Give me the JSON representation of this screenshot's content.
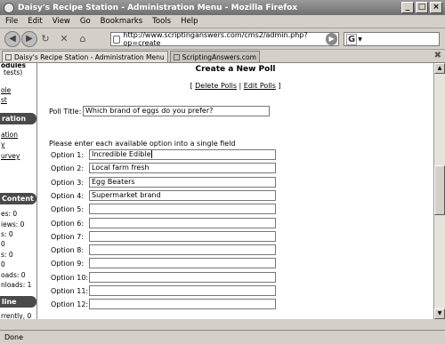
{
  "window": {
    "title": "Daisy's Recipe Station - Administration Menu - Mozilla Firefox"
  },
  "menu": [
    "File",
    "Edit",
    "View",
    "Go",
    "Bookmarks",
    "Tools",
    "Help"
  ],
  "address": {
    "url": "http://www.scriptinganswers.com/cms2/admin.php?op=create"
  },
  "search": {
    "engine": "G"
  },
  "tabs": [
    {
      "label": "Daisy's Recipe Station - Administration Menu"
    },
    {
      "label": "ScriptingAnswers.com"
    }
  ],
  "sidebar": {
    "lines_top": [
      "odules",
      "tests)"
    ],
    "links_top": [
      "ole",
      "st"
    ],
    "header1": "ration",
    "links1": [
      "ation",
      "y",
      "urvey"
    ],
    "header2": "Content",
    "stats": [
      "es: 0",
      "iews: 0",
      "s: 0",
      "0",
      "s: 0",
      "0",
      "oads: 0",
      "nloads: 1"
    ],
    "header3": "line",
    "line_bottom": "rrently, 0"
  },
  "main": {
    "heading": "Create a New Poll",
    "links": {
      "open": "[",
      "delete": "Delete Polls",
      "sep": "|",
      "edit": "Edit Polls",
      "close": "]"
    },
    "poll_title_label": "Poll Title:",
    "poll_title_value": "Which brand of eggs do you prefer?",
    "instructions": "Please enter each available option into a single field",
    "options": [
      {
        "label": "Option 1:",
        "value": "Incredible Edible"
      },
      {
        "label": "Option 2:",
        "value": "Local farm fresh"
      },
      {
        "label": "Option 3:",
        "value": "Egg Beaters"
      },
      {
        "label": "Option 4:",
        "value": "Supermarket brand"
      },
      {
        "label": "Option 5:",
        "value": ""
      },
      {
        "label": "Option 6:",
        "value": ""
      },
      {
        "label": "Option 7:",
        "value": ""
      },
      {
        "label": "Option 8:",
        "value": ""
      },
      {
        "label": "Option 9:",
        "value": ""
      },
      {
        "label": "Option 10:",
        "value": ""
      },
      {
        "label": "Option 11:",
        "value": ""
      },
      {
        "label": "Option 12:",
        "value": ""
      }
    ]
  },
  "status": {
    "text": "Done"
  }
}
